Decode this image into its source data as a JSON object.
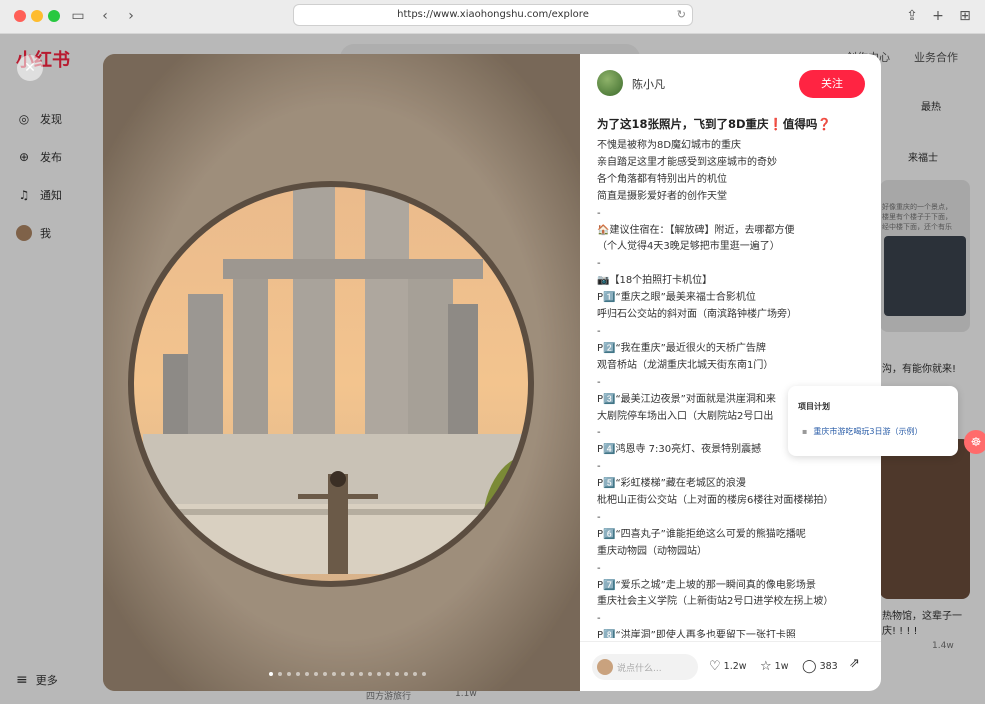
{
  "browser": {
    "url": "https://www.xiaohongshu.com/explore"
  },
  "site": {
    "logo": "小红书",
    "nav": [
      {
        "label": "发现",
        "icon": "compass-icon"
      },
      {
        "label": "发布",
        "icon": "plus-icon"
      },
      {
        "label": "通知",
        "icon": "bell-icon"
      },
      {
        "label": "我",
        "icon": "avatar-icon"
      }
    ],
    "more": "更多",
    "top_links": [
      "创作中心",
      "业务合作"
    ],
    "sort": "最热",
    "bg_tag": "来福士",
    "bg_snippet_1": "好像重庆的一个景点，",
    "bg_snippet_2": "楼里有个楼子于下面，",
    "bg_snippet_3": "经中楼下面，还个有乐",
    "bg_caption_1": "沟，有能你就来!",
    "bg_caption_2": "热物馆，这辈子一",
    "bg_caption_3": "庆! ! ! !",
    "bg_likes": "1.4w",
    "bg_author": "四方游旅行",
    "bg_author_likes": "1.1w"
  },
  "note": {
    "author": "陈小凡",
    "follow_label": "关注",
    "title": "为了这18张照片，飞到了8D重庆❗️值得吗❓",
    "body": [
      "不愧是被称为8D魔幻城市的重庆",
      "亲自踏足这里才能感受到这座城市的奇妙",
      "各个角落都有特别出片的机位",
      "简直是摄影爱好者的创作天堂",
      "-",
      "🏠建议住宿在：【解放碑】附近，去哪都方便",
      "（个人觉得4天3晚足够把市里逛一遍了）",
      "-",
      "📷【18个拍照打卡机位】",
      "P1️⃣“重庆之眼”最美来福士合影机位",
      "呼归石公交站的斜对面（南滨路钟楼广场旁）",
      "-",
      "P2️⃣“我在重庆”最近很火的天桥广告牌",
      "观音桥站（龙湖重庆北城天街东南1门）",
      "-",
      "P3️⃣“最美江边夜景”对面就是洪崖洞和来",
      "大剧院停车场出入口（大剧院站2号口出",
      "-",
      "P4️⃣鸿恩寺 7:30亮灯、夜景特别震撼",
      "-",
      "P5️⃣“彩虹楼梯”藏在老城区的浪漫",
      "枇杷山正街公交站（上对面的楼房6楼往对面楼梯拍）",
      "-",
      "P6️⃣“四喜丸子”谁能拒绝这么可爱的熊猫吃播呢",
      "重庆动物园（动物园站）",
      "-",
      "P7️⃣“爱乐之城”走上坡的那一瞬间真的像电影场景",
      "重庆社会主义学院（上新街站2号口进学校左拐上坡）",
      "-",
      "P8️⃣“洪崖洞”即使人再多也要留下一张打卡照",
      "-"
    ],
    "comment_placeholder": "说点什么...",
    "likes": "1.2w",
    "collects": "1w",
    "comments": "383",
    "image_count": 18,
    "current_image": 1
  },
  "popup": {
    "title": "项目计划",
    "item": "重庆市游吃喝玩3日游（示例）"
  },
  "colors": {
    "brand": "#ff2442"
  }
}
